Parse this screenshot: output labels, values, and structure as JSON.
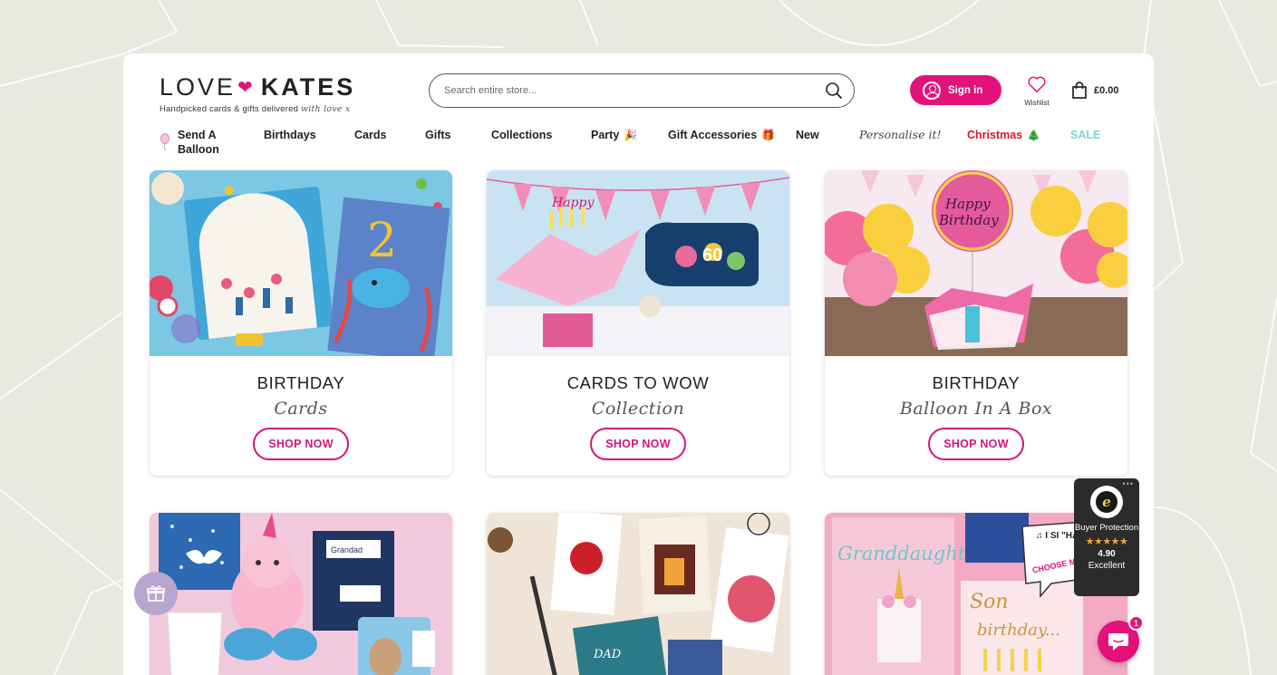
{
  "brand": {
    "logo_word1": "LOVE",
    "logo_heart": "❤",
    "logo_word2": "KATES",
    "tagline": "Handpicked cards & gifts delivered",
    "tagline_script": "with love x",
    "accent_color": "#e2127a"
  },
  "header": {
    "search_placeholder": "Search entire store...",
    "signin_label": "Sign in",
    "wishlist_label": "Wishlist",
    "cart_amount": "£0.00"
  },
  "nav": {
    "items": [
      {
        "label": "Send A Balloon",
        "line1": "Send A",
        "line2": "Balloon"
      },
      {
        "label": "Birthdays"
      },
      {
        "label": "Cards"
      },
      {
        "label": "Gifts"
      },
      {
        "label": "Collections"
      },
      {
        "label": "Party",
        "emoji": "🎉"
      },
      {
        "label": "Gift Accessories",
        "emoji": "🎁"
      },
      {
        "label": "New"
      },
      {
        "label": "Personalise it!"
      },
      {
        "label": "Christmas",
        "emoji": "🎄"
      },
      {
        "label": "SALE"
      }
    ]
  },
  "cards": [
    {
      "title": "BIRTHDAY",
      "subtitle": "Cards",
      "button": "SHOP NOW"
    },
    {
      "title": "CARDS TO WOW",
      "subtitle": "Collection",
      "button": "SHOP NOW"
    },
    {
      "title": "BIRTHDAY",
      "subtitle": "Balloon In A Box",
      "button": "SHOP NOW"
    }
  ],
  "images": {
    "balloon_text": "Happy Birthday",
    "bottom3_text1": "Granddaughter",
    "bottom3_text2": "Son",
    "bottom3_text3": "birthday...",
    "bubble_text": "♫ I SI \"HAPPY B",
    "bubble_text2": "CHOOSE MAKE IT PE",
    "mug_text": "Grandad"
  },
  "trust_badge": {
    "title": "Buyer Protection",
    "stars": "★★★★★",
    "score": "4.90",
    "rating_word": "Excellent",
    "menu": "•••"
  },
  "chat": {
    "badge_count": "1"
  }
}
